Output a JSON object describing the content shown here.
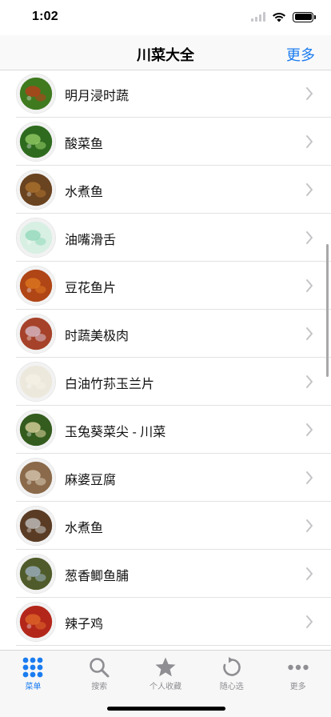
{
  "status": {
    "time": "1:02"
  },
  "nav": {
    "title": "川菜大全",
    "more": "更多"
  },
  "dishes": [
    {
      "label": "明月浸时蔬",
      "icon": "green-vegetable-soup",
      "bg": "#3f7a1f",
      "accent": "#c23a1a"
    },
    {
      "label": "酸菜鱼",
      "icon": "pickled-fish",
      "bg": "#2e6b1f",
      "accent": "#9ad16a"
    },
    {
      "label": "水煮鱼",
      "icon": "boiled-fish",
      "bg": "#6a4320",
      "accent": "#b0742f"
    },
    {
      "label": "油嘴滑舌",
      "icon": "sliced-tongue",
      "bg": "#d8efe4",
      "accent": "#8fd8b8"
    },
    {
      "label": "豆花鱼片",
      "icon": "tofu-fish-slices",
      "bg": "#b04516",
      "accent": "#e07a20"
    },
    {
      "label": "时蔬美极肉",
      "icon": "vegetable-meat",
      "bg": "#a6422a",
      "accent": "#d9c2cf"
    },
    {
      "label": "白油竹荪玉兰片",
      "icon": "bamboo-fungus",
      "bg": "#ece8dc",
      "accent": "#f5f1e6"
    },
    {
      "label": "玉兔葵菜尖 - 川菜",
      "icon": "rabbit-greens",
      "bg": "#335c1e",
      "accent": "#e4d9a4"
    },
    {
      "label": "麻婆豆腐",
      "icon": "mapo-tofu",
      "bg": "#8a6a4a",
      "accent": "#d9cbb6"
    },
    {
      "label": "水煮鱼",
      "icon": "boiled-fish-2",
      "bg": "#5a3c25",
      "accent": "#c9c9c9"
    },
    {
      "label": "葱香鲫鱼脯",
      "icon": "scallion-carp",
      "bg": "#4f5b2a",
      "accent": "#a1b5c8"
    },
    {
      "label": "辣子鸡",
      "icon": "spicy-chicken",
      "bg": "#b3271a",
      "accent": "#e06a2a"
    }
  ],
  "tabs": [
    {
      "label": "菜单",
      "icon": "grid-dots-icon",
      "active": true
    },
    {
      "label": "搜索",
      "icon": "search-icon",
      "active": false
    },
    {
      "label": "个人收藏",
      "icon": "star-icon",
      "active": false
    },
    {
      "label": "随心选",
      "icon": "refresh-icon",
      "active": false
    },
    {
      "label": "更多",
      "icon": "more-dots-icon",
      "active": false
    }
  ],
  "colors": {
    "accent": "#1a7cf0",
    "inactive": "#8e8e93"
  }
}
